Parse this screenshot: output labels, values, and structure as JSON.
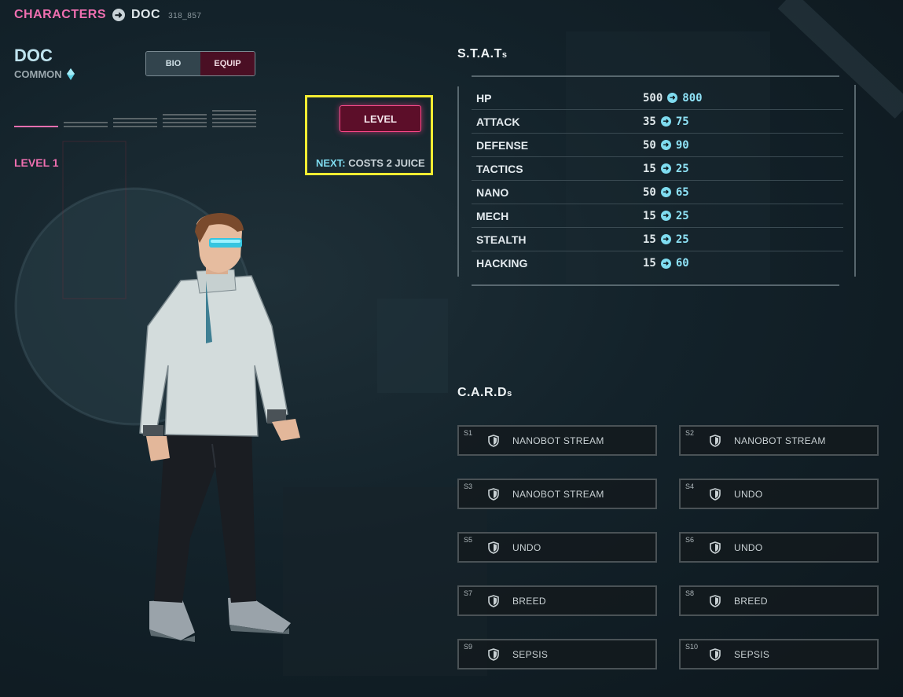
{
  "breadcrumb": {
    "parent": "CHARACTERS",
    "current": "DOC",
    "id": "318_857"
  },
  "character": {
    "name": "DOC",
    "rarity": "COMMON",
    "level_label": "LEVEL 1",
    "level_progress": {
      "current": 1,
      "max": 5
    }
  },
  "tabs": {
    "bio": "BIO",
    "equip": "EQUIP",
    "active": "EQUIP"
  },
  "level_up": {
    "button_label": "LEVEL",
    "next_label": "NEXT:",
    "next_cost": "COSTS 2 JUICE"
  },
  "stats": {
    "title": "S.T.A.T",
    "title_suffix": "s",
    "rows": [
      {
        "name": "HP",
        "from": "500",
        "to": "800"
      },
      {
        "name": "ATTACK",
        "from": "35",
        "to": "75"
      },
      {
        "name": "DEFENSE",
        "from": "50",
        "to": "90"
      },
      {
        "name": "TACTICS",
        "from": "15",
        "to": "25"
      },
      {
        "name": "NANO",
        "from": "50",
        "to": "65"
      },
      {
        "name": "MECH",
        "from": "15",
        "to": "25"
      },
      {
        "name": "STEALTH",
        "from": "15",
        "to": "25"
      },
      {
        "name": "HACKING",
        "from": "15",
        "to": "60"
      }
    ]
  },
  "cards": {
    "title": "C.A.R.D",
    "title_suffix": "s",
    "items": [
      {
        "slot": "S1",
        "name": "NANOBOT STREAM"
      },
      {
        "slot": "S2",
        "name": "NANOBOT STREAM"
      },
      {
        "slot": "S3",
        "name": "NANOBOT STREAM"
      },
      {
        "slot": "S4",
        "name": "UNDO"
      },
      {
        "slot": "S5",
        "name": "UNDO"
      },
      {
        "slot": "S6",
        "name": "UNDO"
      },
      {
        "slot": "S7",
        "name": "BREED"
      },
      {
        "slot": "S8",
        "name": "BREED"
      },
      {
        "slot": "S9",
        "name": "SEPSIS"
      },
      {
        "slot": "S10",
        "name": "SEPSIS"
      }
    ]
  },
  "icons": {
    "breadcrumb_arrow": "arrow-right-circle-icon",
    "rarity": "diamond-icon",
    "stat_arrow": "arrow-right-circle-icon",
    "card": "shield-icon"
  },
  "colors": {
    "accent_pink": "#ef6fb0",
    "accent_cyan": "#7fdcf0",
    "level_button": "#5c0e29",
    "highlight": "#f4ec32"
  }
}
